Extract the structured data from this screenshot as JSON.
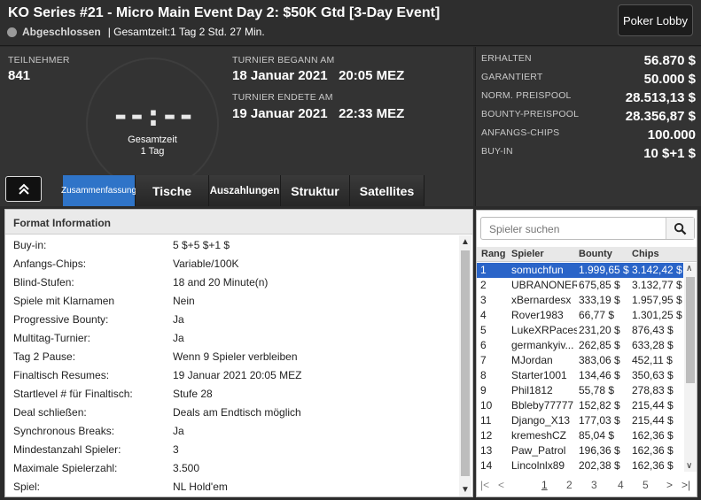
{
  "header": {
    "title": "KO Series #21 - Micro Main Event Day 2: $50K Gtd [3-Day Event]",
    "status": "Abgeschlossen",
    "total_time": "| Gesamtzeit:1 Tag 2 Std.  27 Min.",
    "lobby_button": "Poker Lobby"
  },
  "summary": {
    "participants_label": "TEILNEHMER",
    "participants_value": "841",
    "clock_digits": "--:--",
    "clock_caption_1": "Gesamtzeit",
    "clock_caption_2": "1 Tag",
    "started_label": "TURNIER BEGANN AM",
    "started_value": "18 Januar 2021   20:05 MEZ",
    "ended_label": "TURNIER ENDETE AM",
    "ended_value": "19 Januar 2021   22:33 MEZ",
    "stats": [
      {
        "label": "ERHALTEN",
        "value": "56.870 $"
      },
      {
        "label": "GARANTIERT",
        "value": "50.000 $"
      },
      {
        "label": "NORM. PREISPOOL",
        "value": "28.513,13 $"
      },
      {
        "label": "BOUNTY-PREISPOOL",
        "value": "28.356,87 $"
      },
      {
        "label": "ANFANGS-CHIPS",
        "value": "100.000"
      },
      {
        "label": "BUY-IN",
        "value": "10 $+1 $"
      }
    ]
  },
  "tabs": [
    "Zusammenfassung",
    "Tische",
    "Auszahlungen",
    "Struktur",
    "Satellites"
  ],
  "format": {
    "heading": "Format Information",
    "rows": [
      {
        "label": "Buy-in:",
        "value": "5 $+5 $+1 $"
      },
      {
        "label": "Anfangs-Chips:",
        "value": "Variable/100K"
      },
      {
        "label": "Blind-Stufen:",
        "value": "18 and 20 Minute(n)"
      },
      {
        "label": "Spiele mit Klarnamen",
        "value": "Nein"
      },
      {
        "label": "Progressive Bounty:",
        "value": "Ja"
      },
      {
        "label": "Multitag-Turnier:",
        "value": "Ja"
      },
      {
        "label": "Tag 2 Pause:",
        "value": "Wenn 9 Spieler verbleiben"
      },
      {
        "label": "Finaltisch Resumes:",
        "value": "19 Januar 2021  20:05 MEZ"
      },
      {
        "label": "Startlevel # für  Finaltisch:",
        "value": "Stufe 28"
      },
      {
        "label": "Deal schließen:",
        "value": "Deals am Endtisch möglich"
      },
      {
        "label": "Synchronous Breaks:",
        "value": "Ja"
      },
      {
        "label": "Mindestanzahl Spieler:",
        "value": "3"
      },
      {
        "label": "Maximale Spielerzahl:",
        "value": "3.500"
      },
      {
        "label": "Spiel:",
        "value": "NL Hold'em"
      }
    ]
  },
  "players": {
    "search_placeholder": "Spieler suchen",
    "columns": [
      "Rang",
      "Spieler",
      "Bounty",
      "Chips"
    ],
    "rows": [
      {
        "rank": "1",
        "name": "somuchfun",
        "bounty": "1.999,65 $",
        "chips": "3.142,42 $"
      },
      {
        "rank": "2",
        "name": "UBRANONER",
        "bounty": "675,85 $",
        "chips": "3.132,77 $"
      },
      {
        "rank": "3",
        "name": "xBernardesx",
        "bounty": "333,19 $",
        "chips": "1.957,95 $"
      },
      {
        "rank": "4",
        "name": "Rover1983",
        "bounty": "66,77 $",
        "chips": "1.301,25 $"
      },
      {
        "rank": "5",
        "name": "LukeXRPaces",
        "bounty": "231,20 $",
        "chips": "876,43 $"
      },
      {
        "rank": "6",
        "name": "germankyiv...",
        "bounty": "262,85 $",
        "chips": "633,28 $"
      },
      {
        "rank": "7",
        "name": "MJordan",
        "bounty": "383,06 $",
        "chips": "452,11 $"
      },
      {
        "rank": "8",
        "name": "Starter1001",
        "bounty": "134,46 $",
        "chips": "350,63 $"
      },
      {
        "rank": "9",
        "name": "Phil1812",
        "bounty": "55,78 $",
        "chips": "278,83 $"
      },
      {
        "rank": "10",
        "name": "Bbleby77777",
        "bounty": "152,82 $",
        "chips": "215,44 $"
      },
      {
        "rank": "11",
        "name": "Django_X13",
        "bounty": "177,03 $",
        "chips": "215,44 $"
      },
      {
        "rank": "12",
        "name": "kremeshCZ",
        "bounty": "85,04 $",
        "chips": "162,36 $"
      },
      {
        "rank": "13",
        "name": "Paw_Patrol",
        "bounty": "196,36 $",
        "chips": "162,36 $"
      },
      {
        "rank": "14",
        "name": "Lincolnlx89",
        "bounty": "202,38 $",
        "chips": "162,36 $"
      }
    ],
    "pages": [
      "1",
      "2",
      "3",
      "4",
      "5"
    ],
    "current_page": "1"
  }
}
